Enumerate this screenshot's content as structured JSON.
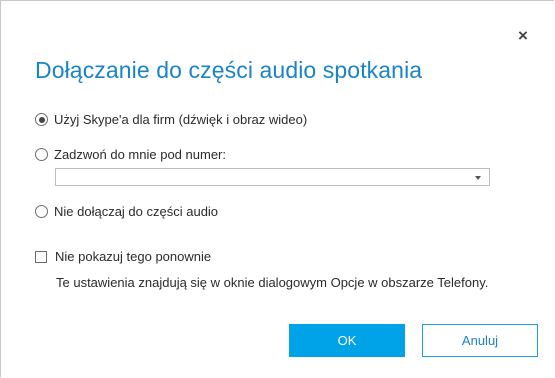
{
  "dialog": {
    "title": "Dołączanie do części audio spotkania",
    "close_icon": "close-icon",
    "close_glyph": "×"
  },
  "options": {
    "skype_label": "Użyj Skype'a dla firm (dźwięk i obraz wideo)",
    "call_me_label": "Zadzwoń do mnie pod numer:",
    "phone_number_value": "",
    "no_audio_label": "Nie dołączaj do części audio",
    "selected": "skype"
  },
  "dont_show": {
    "label": "Nie pokazuj tego ponownie",
    "checked": false
  },
  "info_text": "Te ustawienia znajdują się w oknie dialogowym Opcje w obszarze Telefony.",
  "buttons": {
    "ok_label": "OK",
    "cancel_label": "Anuluj"
  },
  "colors": {
    "accent": "#00a2e8",
    "title": "#1a84c7"
  }
}
